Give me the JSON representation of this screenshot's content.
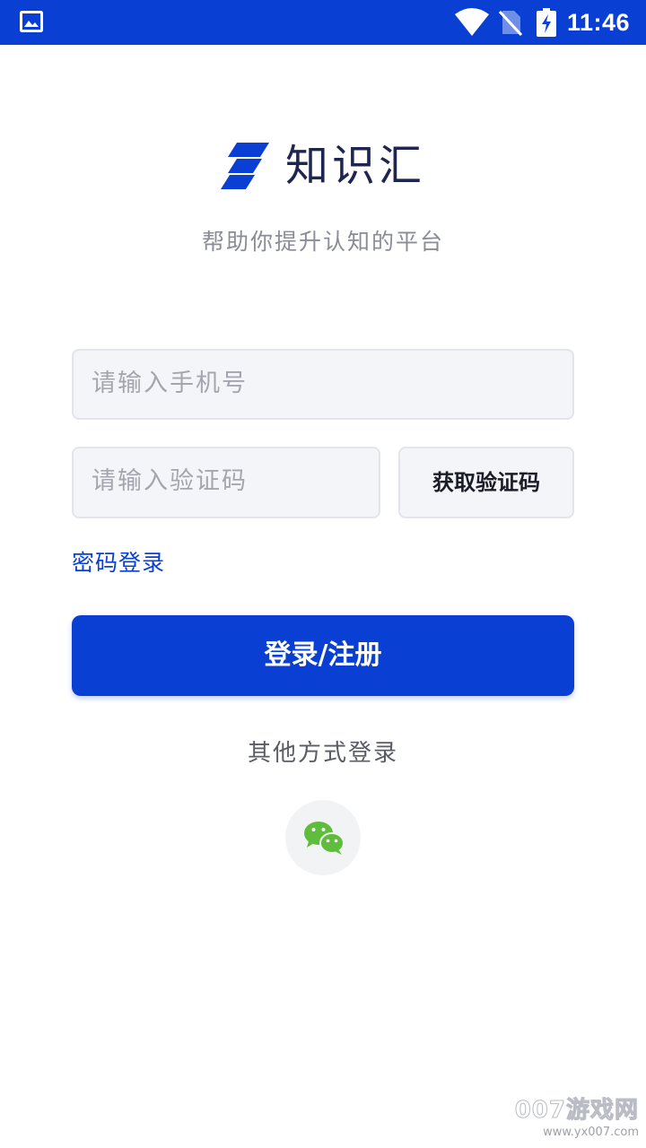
{
  "status_bar": {
    "time": "11:46"
  },
  "header": {
    "app_name": "知识汇",
    "slogan": "帮助你提升认知的平台"
  },
  "form": {
    "phone_placeholder": "请输入手机号",
    "code_placeholder": "请输入验证码",
    "get_code_label": "获取验证码",
    "password_login_link": "密码登录",
    "submit_label": "登录/注册"
  },
  "alt_login": {
    "label": "其他方式登录",
    "icons": [
      "wechat-icon"
    ]
  },
  "colors": {
    "brand_blue": "#0a3fd3",
    "wechat_green": "#5fbd3c"
  },
  "watermark": {
    "brand": "007游戏网",
    "url": "www.yx007.com"
  }
}
